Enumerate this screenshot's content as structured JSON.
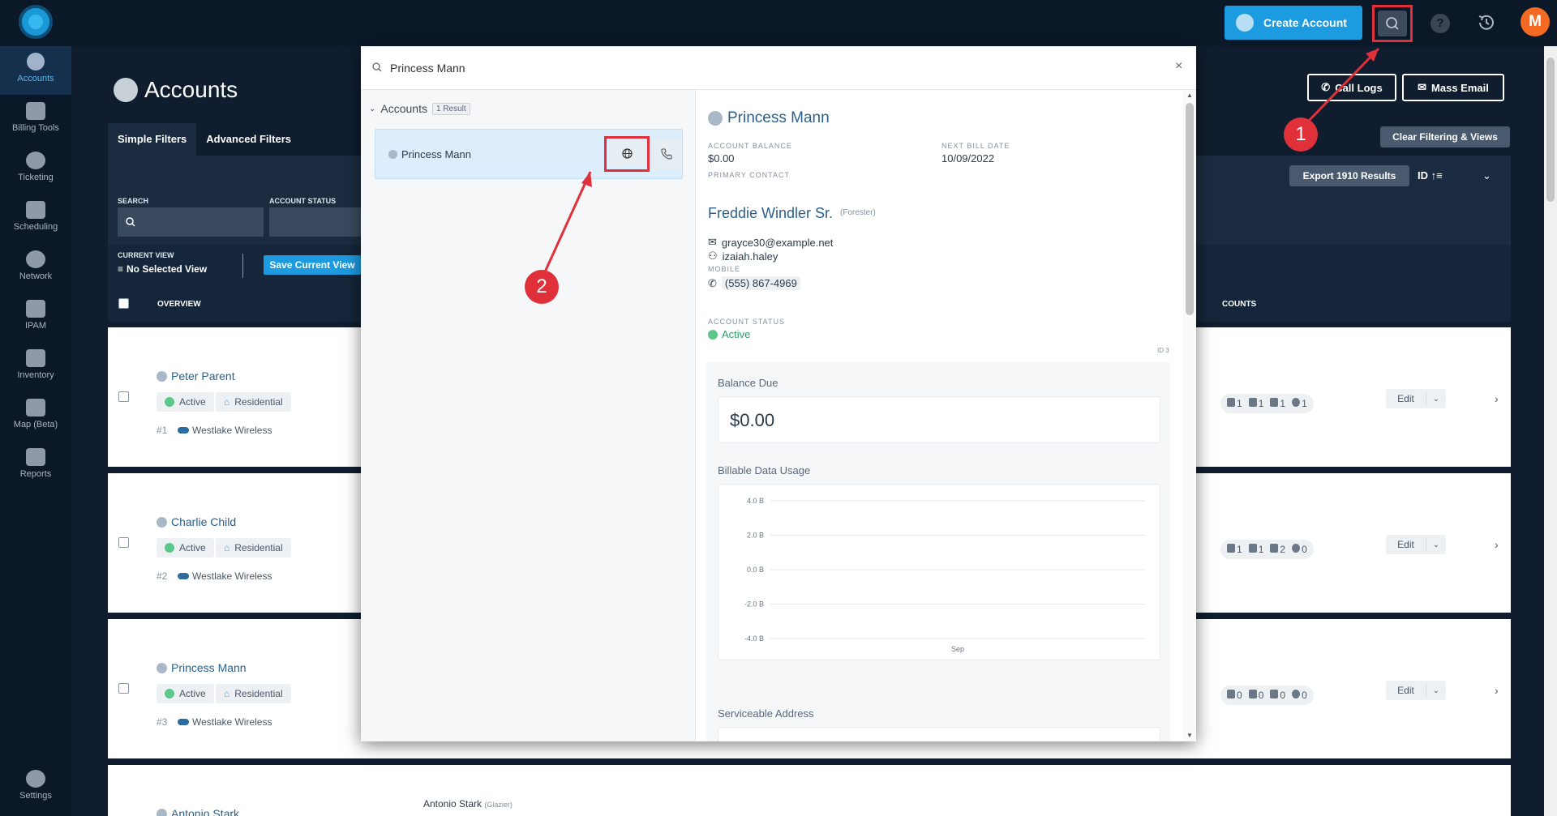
{
  "topbar": {
    "create_account_label": "Create Account",
    "help_label": "?",
    "avatar_initial": "M"
  },
  "sidebar": {
    "items": [
      {
        "label": "Accounts"
      },
      {
        "label": "Billing Tools"
      },
      {
        "label": "Ticketing"
      },
      {
        "label": "Scheduling"
      },
      {
        "label": "Network"
      },
      {
        "label": "IPAM"
      },
      {
        "label": "Inventory"
      },
      {
        "label": "Map (Beta)"
      },
      {
        "label": "Reports"
      },
      {
        "label": "Settings"
      }
    ]
  },
  "page": {
    "title": "Accounts",
    "call_logs_label": "Call Logs",
    "mass_email_label": "Mass Email",
    "clear_label": "Clear Filtering & Views",
    "tabs": [
      "Simple Filters",
      "Advanced Filters"
    ],
    "search_label": "SEARCH",
    "account_status_label": "ACCOUNT STATUS",
    "export_label": "Export 1910 Results",
    "sort_label": "ID",
    "current_view_label": "CURRENT VIEW",
    "current_view_value": "No Selected View",
    "save_view_label": "Save Current View",
    "col_overview": "OVERVIEW",
    "col_counts": "COUNTS"
  },
  "rows": [
    {
      "name": "Peter Parent",
      "status": "Active",
      "type": "Residential",
      "num": "#1",
      "isp": "Westlake Wireless",
      "counts": [
        "1",
        "1",
        "1",
        "1"
      ],
      "edit": "Edit"
    },
    {
      "name": "Charlie Child",
      "status": "Active",
      "type": "Residential",
      "num": "#2",
      "isp": "Westlake Wireless",
      "counts": [
        "1",
        "1",
        "2",
        "0"
      ],
      "edit": "Edit"
    },
    {
      "name": "Princess Mann",
      "status": "Active",
      "type": "Residential",
      "num": "#3",
      "isp": "Westlake Wireless",
      "counts": [
        "0",
        "0",
        "0",
        "0"
      ],
      "edit": "Edit"
    },
    {
      "name": "Antonio Stark",
      "contact": "Antonio Stark",
      "contact_role": "(Glazier)"
    }
  ],
  "modal": {
    "search_value": "Princess Mann",
    "close_label": "×",
    "group_label": "Accounts",
    "group_count": "1 Result",
    "result_name": "Princess Mann",
    "detail": {
      "name": "Princess Mann",
      "balance_label": "ACCOUNT BALANCE",
      "balance_value": "$0.00",
      "next_bill_label": "NEXT BILL DATE",
      "next_bill_value": "10/09/2022",
      "primary_contact_label": "PRIMARY CONTACT",
      "contact_name": "Freddie Windler Sr.",
      "contact_role": "(Forester)",
      "email": "grayce30@example.net",
      "username": "izaiah.haley",
      "mobile_label": "MOBILE",
      "mobile": "(555) 867-4969",
      "status_label": "ACCOUNT STATUS",
      "status_value": "Active",
      "id_label": "ID 3",
      "balance_due_title": "Balance Due",
      "balance_due_value": "$0.00",
      "usage_title": "Billable Data Usage",
      "address_title": "Serviceable Address"
    }
  },
  "chart_data": {
    "type": "line",
    "title": "",
    "xlabel": "",
    "ylabel": "",
    "x_ticks": [
      "Sep"
    ],
    "y_ticks": [
      "4.0 B",
      "2.0 B",
      "0.0 B",
      "-2.0 B",
      "-4.0 B"
    ],
    "ylim": [
      -4,
      4
    ],
    "series": []
  },
  "annotations": {
    "one": "1",
    "two": "2"
  },
  "colors": {
    "accent": "#1d9be0",
    "highlight": "#e0303a",
    "active_green": "#5bc88a"
  }
}
